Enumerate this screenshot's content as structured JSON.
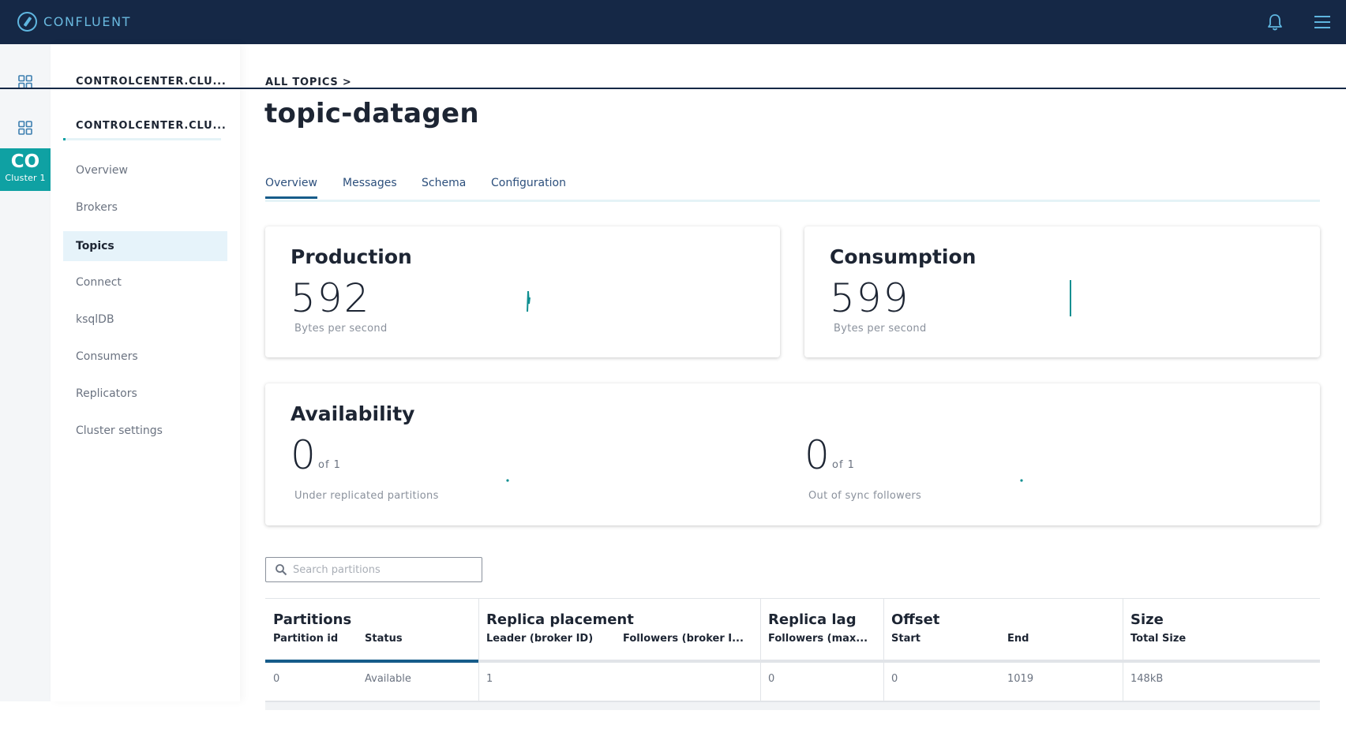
{
  "app": {
    "brand": "CONFLUENT"
  },
  "rail": {
    "cluster_abbr": "CO",
    "cluster_name": "Cluster 1"
  },
  "nav": {
    "cluster_header_top": "CONTROLCENTER.CLU...",
    "cluster_header": "CONTROLCENTER.CLU...",
    "items": [
      {
        "label": "Overview"
      },
      {
        "label": "Brokers"
      },
      {
        "label": "Topics",
        "active": true
      },
      {
        "label": "Connect"
      },
      {
        "label": "ksqlDB"
      },
      {
        "label": "Consumers"
      },
      {
        "label": "Replicators"
      },
      {
        "label": "Cluster settings"
      }
    ]
  },
  "breadcrumb": {
    "label": "ALL TOPICS >"
  },
  "page": {
    "title": "topic-datagen"
  },
  "tabs": [
    {
      "label": "Overview",
      "active": true
    },
    {
      "label": "Messages"
    },
    {
      "label": "Schema"
    },
    {
      "label": "Configuration"
    }
  ],
  "production": {
    "title": "Production",
    "value": "592",
    "unit": "Bytes per second"
  },
  "consumption": {
    "title": "Consumption",
    "value": "599",
    "unit": "Bytes per second"
  },
  "availability": {
    "title": "Availability",
    "under_replicated": {
      "value": "0",
      "of": "of 1",
      "label": "Under replicated partitions"
    },
    "out_of_sync": {
      "value": "0",
      "of": "of 1",
      "label": "Out of sync followers"
    }
  },
  "search": {
    "placeholder": "Search partitions",
    "value": ""
  },
  "table": {
    "groups": {
      "partitions": "Partitions",
      "replica_placement": "Replica placement",
      "replica_lag": "Replica lag",
      "offset": "Offset",
      "size": "Size"
    },
    "columns": {
      "partition_id": "Partition id",
      "status": "Status",
      "leader": "Leader (broker ID)",
      "followers": "Followers (broker I...",
      "followers_max": "Followers (max...",
      "start": "Start",
      "end": "End",
      "total_size": "Total Size"
    },
    "rows": [
      {
        "partition_id": "0",
        "status": "Available",
        "leader": "1",
        "followers": "",
        "followers_max": "0",
        "start": "0",
        "end": "1019",
        "total_size": "148kB"
      }
    ]
  },
  "colors": {
    "topbar": "#152846",
    "accent_teal": "#0fa1a3",
    "tab_active": "#165c8a",
    "nav_active_bg": "#e6f3fa"
  },
  "icons": [
    "confluent-logo-icon",
    "bell-icon",
    "hamburger-menu-icon",
    "grid-icon",
    "search-icon"
  ]
}
